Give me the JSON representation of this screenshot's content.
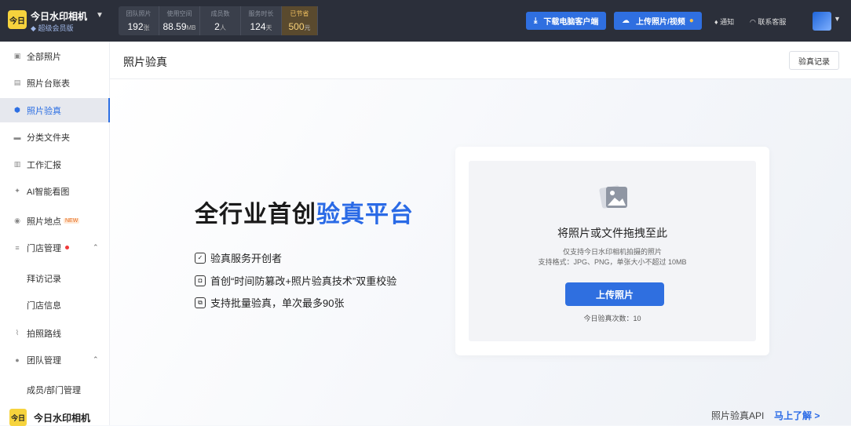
{
  "topbar": {
    "app_name": "今日水印相机",
    "logo_text": "今日",
    "member": "超级会员版",
    "stats": [
      {
        "label": "团队照片",
        "value": "192",
        "unit": "张"
      },
      {
        "label": "使用空间",
        "value": "88.59",
        "unit": "MB"
      },
      {
        "label": "成员数",
        "value": "2",
        "unit": "人"
      },
      {
        "label": "服务时长",
        "value": "124",
        "unit": "天"
      },
      {
        "label": "已节省",
        "value": "500",
        "unit": "元"
      }
    ],
    "download_btn": "下载电脑客户端",
    "upload_btn": "上传照片/视频",
    "notify": "通知",
    "support": "联系客服"
  },
  "sidebar": {
    "items": [
      {
        "label": "全部照片",
        "icon": "photo-icon"
      },
      {
        "label": "照片台账表",
        "icon": "sheet-icon"
      },
      {
        "label": "照片验真",
        "icon": "shield-icon"
      },
      {
        "label": "分类文件夹",
        "icon": "folder-icon"
      },
      {
        "label": "工作汇报",
        "icon": "report-icon"
      },
      {
        "label": "AI智能看图",
        "icon": "ai-icon"
      },
      {
        "label": "照片地点",
        "icon": "location-icon",
        "badge": "NEW"
      },
      {
        "label": "门店管理",
        "icon": "store-icon"
      },
      {
        "label": "拍照路线",
        "icon": "route-icon"
      },
      {
        "label": "团队管理",
        "icon": "team-icon"
      }
    ],
    "store_sub": [
      "拜访记录",
      "门店信息"
    ],
    "team_sub": [
      "成员/部门管理"
    ],
    "bottom_name": "今日水印相机"
  },
  "main": {
    "title": "照片验真",
    "record_btn": "验真记录",
    "hero_part1": "全行业首创",
    "hero_part2": "验真平台",
    "features": [
      "验真服务开创者",
      "首创“时间防篡改+照片验真技术”双重校验",
      "支持批量验真，单次最多90张"
    ],
    "drop_title": "将照片或文件拖拽至此",
    "drop_sub1": "仅支持今日水印相机拍摄的照片",
    "drop_sub2": "支持格式：JPG、PNG，单张大小不超过 10MB",
    "upload_btn": "上传照片",
    "count": "今日验真次数：10",
    "api_label": "照片验真API",
    "api_link": "马上了解 >"
  }
}
